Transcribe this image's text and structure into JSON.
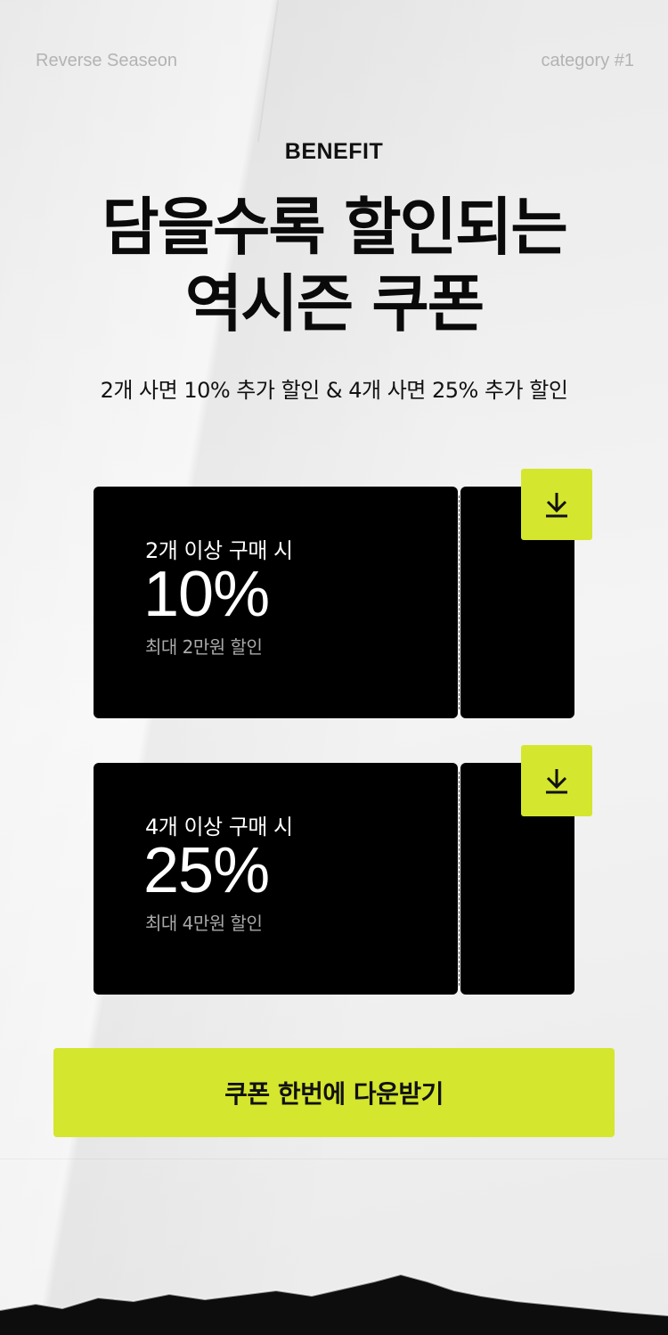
{
  "header": {
    "left_text": "Reverse Seaseon",
    "right_text": "category #1"
  },
  "hero": {
    "eyebrow": "BENEFIT",
    "title_line1": "담을수록 할인되는",
    "title_line2": "역시즌 쿠폰",
    "subtitle": "2개 사면 10% 추가 할인 & 4개 사면 25% 추가 할인"
  },
  "coupons": [
    {
      "condition": "2개 이상 구매 시",
      "discount": "10%",
      "max": "최대 2만원 할인",
      "icon": "download-icon"
    },
    {
      "condition": "4개 이상 구매 시",
      "discount": "25%",
      "max": "최대 4만원 할인",
      "icon": "download-icon"
    }
  ],
  "cta": {
    "label": "쿠폰 한번에 다운받기"
  },
  "colors": {
    "background": "#efefef",
    "accent": "#d4e62e",
    "coupon": "#000000",
    "muted": "#a9a9a9"
  }
}
